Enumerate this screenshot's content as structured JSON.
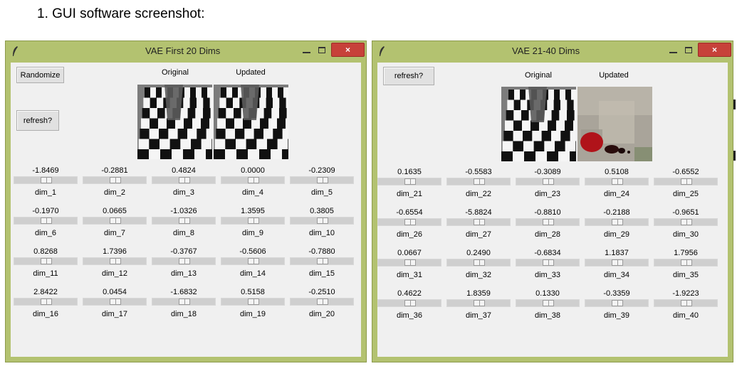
{
  "caption": "1.   GUI software screenshot:",
  "left_window": {
    "title": "VAE First 20 Dims",
    "randomize_label": "Randomize",
    "refresh_label": "refresh?",
    "original_label": "Original",
    "updated_label": "Updated",
    "close_glyph": "×",
    "values": [
      "-1.8469",
      "-0.2881",
      "0.4824",
      "0.0000",
      "-0.2309",
      "-0.1970",
      "0.0665",
      "-1.0326",
      "1.3595",
      "0.3805",
      "0.8268",
      "1.7396",
      "-0.3767",
      "-0.5606",
      "-0.7880",
      "2.8422",
      "0.0454",
      "-1.6832",
      "0.5158",
      "-0.2510"
    ],
    "names": [
      "dim_1",
      "dim_2",
      "dim_3",
      "dim_4",
      "dim_5",
      "dim_6",
      "dim_7",
      "dim_8",
      "dim_9",
      "dim_10",
      "dim_11",
      "dim_12",
      "dim_13",
      "dim_14",
      "dim_15",
      "dim_16",
      "dim_17",
      "dim_18",
      "dim_19",
      "dim_20"
    ]
  },
  "right_window": {
    "title": "VAE 21-40 Dims",
    "refresh_label": "refresh?",
    "original_label": "Original",
    "updated_label": "Updated",
    "close_glyph": "×",
    "values": [
      "0.1635",
      "-0.5583",
      "-0.3089",
      "0.5108",
      "-0.6552",
      "-0.6554",
      "-5.8824",
      "-0.8810",
      "-0.2188",
      "-0.9651",
      "0.0667",
      "0.2490",
      "-0.6834",
      "1.1837",
      "1.7956",
      "0.4622",
      "1.8359",
      "0.1330",
      "-0.3359",
      "-1.9223"
    ],
    "names": [
      "dim_21",
      "dim_22",
      "dim_23",
      "dim_24",
      "dim_25",
      "dim_26",
      "dim_27",
      "dim_28",
      "dim_29",
      "dim_30",
      "dim_31",
      "dim_32",
      "dim_33",
      "dim_34",
      "dim_35",
      "dim_36",
      "dim_37",
      "dim_38",
      "dim_39",
      "dim_40"
    ]
  },
  "icons": [
    "feather-icon",
    "minimize-icon",
    "maximize-icon",
    "close-icon"
  ],
  "colors": {
    "titlebar": "#b3c270",
    "close": "#c7413a",
    "client": "#f0f0f0"
  }
}
